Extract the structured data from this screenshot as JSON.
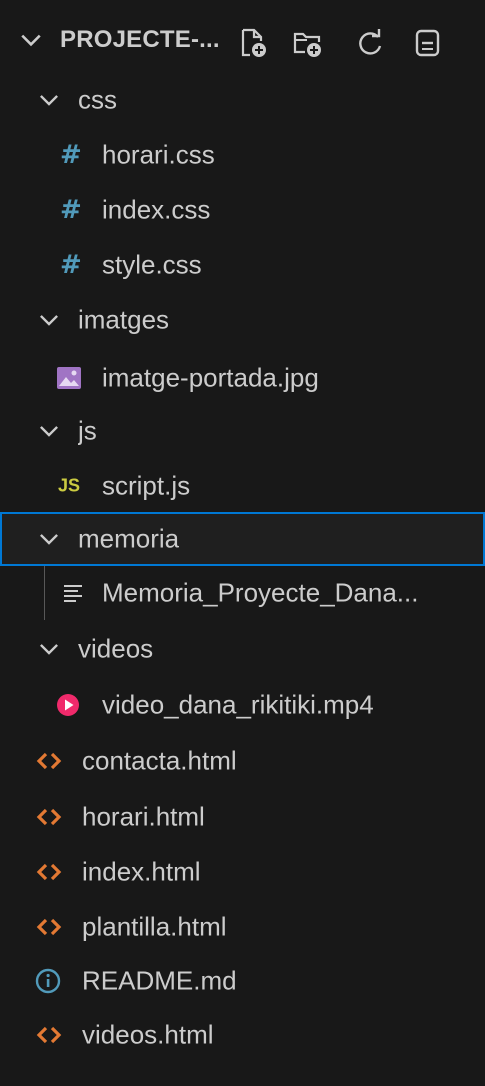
{
  "explorer": {
    "title": "PROJECTE-...",
    "actions": [
      {
        "name": "new-file",
        "icon": "new-file-icon"
      },
      {
        "name": "new-folder",
        "icon": "new-folder-icon"
      },
      {
        "name": "refresh",
        "icon": "refresh-icon"
      },
      {
        "name": "collapse-all",
        "icon": "collapse-all-icon"
      }
    ],
    "items": [
      {
        "label": "css",
        "kind": "folder",
        "icon": "chevron-down-icon"
      },
      {
        "label": "horari.css",
        "kind": "file",
        "icon": "css-file-icon",
        "glyph": "#"
      },
      {
        "label": "index.css",
        "kind": "file",
        "icon": "css-file-icon",
        "glyph": "#"
      },
      {
        "label": "style.css",
        "kind": "file",
        "icon": "css-file-icon",
        "glyph": "#"
      },
      {
        "label": "imatges",
        "kind": "folder",
        "icon": "chevron-down-icon"
      },
      {
        "label": "imatge-portada.jpg",
        "kind": "file",
        "icon": "image-file-icon"
      },
      {
        "label": "js",
        "kind": "folder",
        "icon": "chevron-down-icon"
      },
      {
        "label": "script.js",
        "kind": "file",
        "icon": "js-file-icon",
        "glyph": "JS"
      },
      {
        "label": "memoria",
        "kind": "folder",
        "icon": "chevron-down-icon",
        "selected": true
      },
      {
        "label": "Memoria_Proyecte_Dana...",
        "kind": "file",
        "icon": "text-file-icon"
      },
      {
        "label": "videos",
        "kind": "folder",
        "icon": "chevron-down-icon"
      },
      {
        "label": "video_dana_rikitiki.mp4",
        "kind": "file",
        "icon": "video-file-icon"
      },
      {
        "label": "contacta.html",
        "kind": "file",
        "icon": "html-file-icon"
      },
      {
        "label": "horari.html",
        "kind": "file",
        "icon": "html-file-icon"
      },
      {
        "label": "index.html",
        "kind": "file",
        "icon": "html-file-icon"
      },
      {
        "label": "plantilla.html",
        "kind": "file",
        "icon": "html-file-icon"
      },
      {
        "label": "README.md",
        "kind": "file",
        "icon": "info-file-icon"
      },
      {
        "label": "videos.html",
        "kind": "file",
        "icon": "html-file-icon"
      }
    ]
  },
  "colors": {
    "background": "#181818",
    "text": "#cccccc",
    "selection_border": "#0078d4",
    "css_icon": "#519aba",
    "js_icon": "#cbcb41",
    "html_icon": "#e37933",
    "video_icon": "#f02a6b",
    "info_icon": "#519aba",
    "image_icon": "#a074c4"
  }
}
